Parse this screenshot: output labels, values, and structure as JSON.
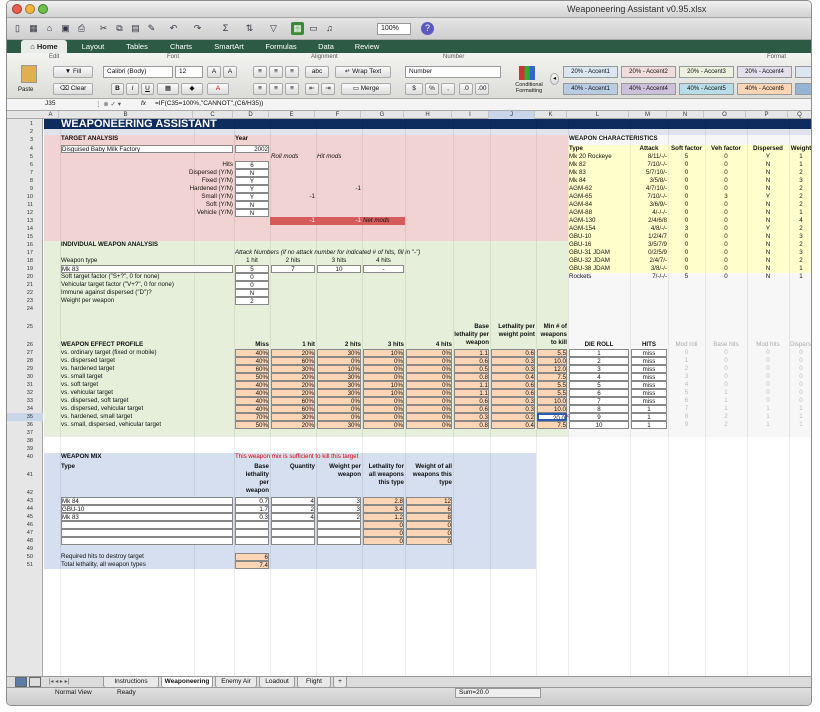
{
  "window": {
    "title": "Weaponeering Assistant v0.95.xlsx"
  },
  "toolbar": {
    "zoom": "100%"
  },
  "ribbon": {
    "tabs": [
      "Home",
      "Layout",
      "Tables",
      "Charts",
      "SmartArt",
      "Formulas",
      "Data",
      "Review"
    ],
    "groups": [
      "Edit",
      "Font",
      "Alignment",
      "Number",
      "Format"
    ],
    "fill": "Fill",
    "clear": "Clear",
    "paste": "Paste",
    "font": "Calibri (Body)",
    "size": "12",
    "wrap": "Wrap Text",
    "merge": "Merge",
    "number_format": "Number",
    "conditional": "Conditional Formatting",
    "styles_row1": [
      "20% - Accent1",
      "20% - Accent2",
      "20% - Accent3",
      "20% - Accent4",
      "20%"
    ],
    "styles_row2": [
      "40% - Accent1",
      "40% - Accent4",
      "40% - Accent5",
      "40% - Accent6",
      "60%"
    ],
    "style_colors_row1": [
      "#dce6f1",
      "#f2dcdb",
      "#ebf1de",
      "#e4dfec",
      "#dce6f1"
    ],
    "style_colors_row2": [
      "#b8cce4",
      "#ccc0da",
      "#b7dee8",
      "#fcd5b4",
      "#95b3d7"
    ]
  },
  "formula": {
    "cell": "J35",
    "text": "=IF(C35=100%,\"CANNOT\",(C6/H35))"
  },
  "columns": [
    "A",
    "B",
    "C",
    "D",
    "E",
    "F",
    "G",
    "H",
    "I",
    "J",
    "K",
    "L",
    "M",
    "N",
    "O",
    "P",
    "Q"
  ],
  "rows": [
    "1",
    "2",
    "3",
    "4",
    "5",
    "6",
    "7",
    "8",
    "9",
    "10",
    "11",
    "12",
    "13",
    "14",
    "15",
    "16",
    "17",
    "18",
    "19",
    "20",
    "21",
    "22",
    "23",
    "24",
    "25",
    "26",
    "27",
    "28",
    "29",
    "30",
    "31",
    "32",
    "33",
    "34",
    "35",
    "36",
    "37",
    "38",
    "39",
    "40",
    "41",
    "42",
    "43",
    "44",
    "45",
    "46",
    "47",
    "48",
    "49",
    "50",
    "51"
  ],
  "sheet": {
    "title": "WEAPONEERING ASSISTANT",
    "target": {
      "header": "TARGET ANALYSIS",
      "year_header": "Year",
      "name": "Disguised Baby Milk Factory",
      "year": "2002",
      "rollmods": "Roll mods",
      "hitmods": "Hit mods",
      "labels": [
        "Hits",
        "Dispersed (Y/N)",
        "Fixed (Y/N)",
        "Hardened (Y/N)",
        "Small (Y/N)",
        "Soft (Y/N)",
        "Vehicle (Y/N)"
      ],
      "values": [
        "6",
        "N",
        "Y",
        "Y",
        "Y",
        "N",
        "N"
      ],
      "hardened_mod": "-1",
      "small_mod": "-1",
      "total_roll": "-1",
      "total_hit": "-1",
      "netmods": "Net mods"
    },
    "weapon": {
      "header": "INDIVIDUAL WEAPON ANALYSIS",
      "attack_note": "Attack Numbers (if no attack number for indicated # of hits, fill in \"-\")",
      "hits_headers": [
        "1 hit",
        "2 hits",
        "3 hits",
        "4 hits"
      ],
      "type_label": "Weapon type",
      "type": "Mk 83",
      "attack": [
        "5",
        "7",
        "10",
        "-"
      ],
      "labels": [
        "Soft target factor (\"S+?\", 0 for none)",
        "Vehicular target factor (\"V+?\", 0 for none)",
        "Immune against dispersed (\"D\")?",
        "Weight per weapon"
      ],
      "values": [
        "0",
        "0",
        "N",
        "2"
      ]
    },
    "effect": {
      "header": "WEAPON EFFECT PROFILE",
      "col_headers": [
        "Miss",
        "1 hit",
        "2 hits",
        "3 hits",
        "4 hits"
      ],
      "base_lethality_header": "Base lethality per weapon",
      "lethality_weight_header": "Lethality per weight point",
      "min_weapons_header": "Min # of weapons to kill",
      "rows": [
        {
          "label": "vs. ordinary target (fixed or mobile)",
          "v": [
            "40%",
            "20%",
            "30%",
            "10%",
            "0%",
            "1.1",
            "0.6",
            "5.5"
          ]
        },
        {
          "label": "vs. dispersed target",
          "v": [
            "40%",
            "60%",
            "0%",
            "0%",
            "0%",
            "0.6",
            "0.3",
            "10.0"
          ]
        },
        {
          "label": "vs. hardened target",
          "v": [
            "60%",
            "30%",
            "10%",
            "0%",
            "0%",
            "0.5",
            "0.3",
            "12.0"
          ]
        },
        {
          "label": "vs. small target",
          "v": [
            "50%",
            "20%",
            "30%",
            "0%",
            "0%",
            "0.8",
            "0.4",
            "7.5"
          ]
        },
        {
          "label": "vs. soft target",
          "v": [
            "40%",
            "20%",
            "30%",
            "10%",
            "0%",
            "1.1",
            "0.6",
            "5.5"
          ]
        },
        {
          "label": "vs. vehicular target",
          "v": [
            "40%",
            "20%",
            "30%",
            "10%",
            "0%",
            "1.1",
            "0.6",
            "5.5"
          ]
        },
        {
          "label": "vs. dispersed, soft target",
          "v": [
            "40%",
            "60%",
            "0%",
            "0%",
            "0%",
            "0.6",
            "0.3",
            "10.0"
          ]
        },
        {
          "label": "vs. dispersed, vehicular target",
          "v": [
            "40%",
            "60%",
            "0%",
            "0%",
            "0%",
            "0.6",
            "0.3",
            "10.0"
          ]
        },
        {
          "label": "vs. hardened, small target",
          "v": [
            "70%",
            "30%",
            "0%",
            "0%",
            "0%",
            "0.3",
            "0.2",
            "20.0"
          ]
        },
        {
          "label": "vs. small, dispersed, vehicular target",
          "v": [
            "50%",
            "20%",
            "30%",
            "0%",
            "0%",
            "0.8",
            "0.4",
            "7.5"
          ]
        }
      ],
      "this_target": "<< This target"
    },
    "die": {
      "header_roll": "DIE ROLL",
      "header_hits": "HITS",
      "mod_headers": [
        "Mod roll",
        "Base hits",
        "Mod hits",
        "Dispersed"
      ],
      "rows": [
        {
          "roll": "1",
          "hits": "miss",
          "m": [
            "0",
            "0",
            "0",
            "0"
          ]
        },
        {
          "roll": "2",
          "hits": "miss",
          "m": [
            "1",
            "0",
            "0",
            "0"
          ]
        },
        {
          "roll": "3",
          "hits": "miss",
          "m": [
            "2",
            "0",
            "0",
            "0"
          ]
        },
        {
          "roll": "4",
          "hits": "miss",
          "m": [
            "3",
            "0",
            "0",
            "0"
          ]
        },
        {
          "roll": "5",
          "hits": "miss",
          "m": [
            "4",
            "0",
            "0",
            "0"
          ]
        },
        {
          "roll": "6",
          "hits": "miss",
          "m": [
            "5",
            "1",
            "0",
            "0"
          ]
        },
        {
          "roll": "7",
          "hits": "miss",
          "m": [
            "6",
            "1",
            "0",
            "0"
          ]
        },
        {
          "roll": "8",
          "hits": "1",
          "m": [
            "7",
            "1",
            "1",
            "1"
          ]
        },
        {
          "roll": "9",
          "hits": "1",
          "m": [
            "8",
            "2",
            "1",
            "1"
          ]
        },
        {
          "roll": "10",
          "hits": "1",
          "m": [
            "9",
            "2",
            "1",
            "1"
          ]
        }
      ]
    },
    "characteristics": {
      "header": "WEAPON CHARACTERISTICS",
      "col_headers": [
        "Type",
        "Attack",
        "Soft factor",
        "Veh factor",
        "Dispersed",
        "Weight"
      ],
      "rows": [
        [
          "Mk 20 Rockeye",
          "8/11/-/-",
          "5",
          "0",
          "Y",
          "1"
        ],
        [
          "Mk 82",
          "7/10/-/-",
          "0",
          "0",
          "N",
          "1"
        ],
        [
          "Mk 83",
          "5/7/10/-",
          "0",
          "0",
          "N",
          "2"
        ],
        [
          "Mk 84",
          "3/5/8/-",
          "0",
          "0",
          "N",
          "3"
        ],
        [
          "AGM-62",
          "4/7/10/-",
          "0",
          "0",
          "N",
          "2"
        ],
        [
          "AGM-65",
          "7/10/-/-",
          "0",
          "3",
          "Y",
          "2"
        ],
        [
          "AGM-84",
          "3/6/9/-",
          "0",
          "0",
          "N",
          "2"
        ],
        [
          "AGM-88",
          "4/-/-/-",
          "0",
          "0",
          "N",
          "1"
        ],
        [
          "AGM-130",
          "2/4/6/8",
          "0",
          "0",
          "N",
          "4"
        ],
        [
          "AGM-154",
          "4/8/-/-",
          "3",
          "0",
          "Y",
          "2"
        ],
        [
          "GBU-10",
          "1/2/4/7",
          "0",
          "0",
          "N",
          "3"
        ],
        [
          "GBU-16",
          "3/5/7/9",
          "0",
          "0",
          "N",
          "2"
        ],
        [
          "GBU-31 JDAM",
          "0/2/5/9",
          "0",
          "0",
          "N",
          "3"
        ],
        [
          "GBU-32 JDAM",
          "2/4/7/-",
          "0",
          "0",
          "N",
          "2"
        ],
        [
          "GBU-38 JDAM",
          "3/8/-/-",
          "0",
          "0",
          "N",
          "1"
        ],
        [
          "Rockets",
          "7/-/-/-",
          "5",
          "0",
          "N",
          "1"
        ]
      ]
    },
    "mix": {
      "header": "WEAPON MIX",
      "message": "This weapon mix is sufficient to kill this target",
      "col_headers": [
        "Type",
        "Base lethality per weapon",
        "Quantity",
        "Weight per weapon",
        "Lethality for all weapons this type",
        "Weight of all weapons this type"
      ],
      "rows": [
        [
          "Mk 84",
          "0.7",
          "4",
          "3",
          "2.8",
          "12"
        ],
        [
          "GBU-10",
          "1.7",
          "2",
          "3",
          "3.4",
          "6"
        ],
        [
          "Mk 83",
          "0.3",
          "4",
          "2",
          "1.2",
          "8"
        ],
        [
          "",
          "",
          "",
          "",
          "0",
          "0"
        ],
        [
          "",
          "",
          "",
          "",
          "0",
          "0"
        ],
        [
          "",
          "",
          "",
          "",
          "0",
          "0"
        ]
      ],
      "required_label": "Required hits to destroy target",
      "required": "6",
      "total_label": "Total lethality, all weapon types",
      "total": "7.4"
    }
  },
  "sheet_tabs": [
    "Instructions",
    "Weaponeering",
    "Enemy Air",
    "Loadout",
    "Flight",
    "+"
  ],
  "status": {
    "view": "Normal View",
    "ready": "Ready",
    "sum": "Sum=20.0"
  }
}
